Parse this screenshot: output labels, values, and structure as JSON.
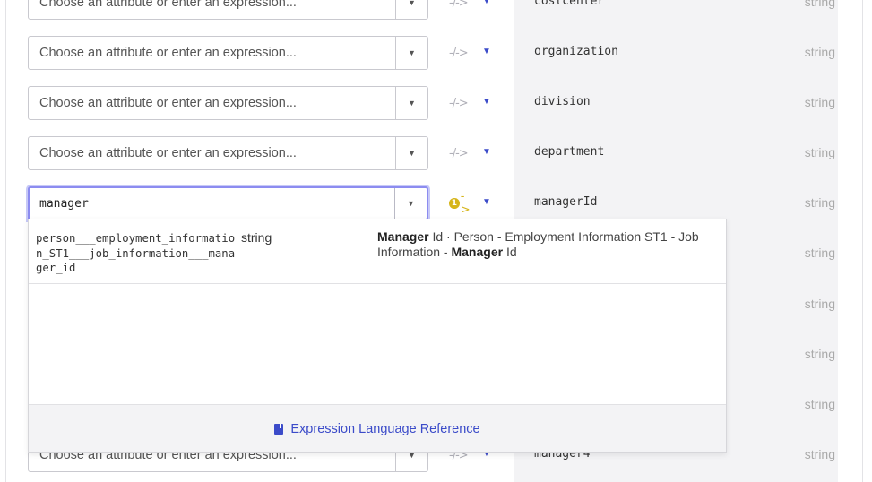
{
  "rows": [
    {
      "placeholder": "Choose an attribute or enter an expression...",
      "value": "",
      "attribute": "costcenter",
      "type": "string"
    },
    {
      "placeholder": "Choose an attribute or enter an expression...",
      "value": "",
      "attribute": "organization",
      "type": "string"
    },
    {
      "placeholder": "Choose an attribute or enter an expression...",
      "value": "",
      "attribute": "division",
      "type": "string"
    },
    {
      "placeholder": "Choose an attribute or enter an expression...",
      "value": "",
      "attribute": "department",
      "type": "string"
    },
    {
      "placeholder": "",
      "value": "manager",
      "attribute": "managerId",
      "type": "string",
      "badge": "1"
    },
    {
      "type": "string"
    },
    {
      "type": "string"
    },
    {
      "type": "string"
    },
    {
      "type": "string"
    },
    {
      "placeholder": "Choose an attribute or enter an expression...",
      "value": "",
      "attribute": "manager4",
      "type": "string"
    }
  ],
  "dropdown": {
    "suggestion": {
      "path": "person___employment_information_ST1___job_information___manager_id",
      "type": "string",
      "desc_bold_1": "Manager",
      "desc_part_1": " Id · Person - Employment Information ST1 - Job Information - ",
      "desc_bold_2": "Manager",
      "desc_part_2": " Id"
    },
    "footer_link": "Expression Language Reference"
  },
  "colors": {
    "accent": "#3b4bc9",
    "focus_ring": "#8c8cf0",
    "warning_badge": "#d6b51a",
    "panel_bg": "#f3f3f5"
  },
  "icons": {
    "mapping": "arrow-mapping-icon",
    "caret": "chevron-down-icon",
    "doc": "book-icon"
  }
}
